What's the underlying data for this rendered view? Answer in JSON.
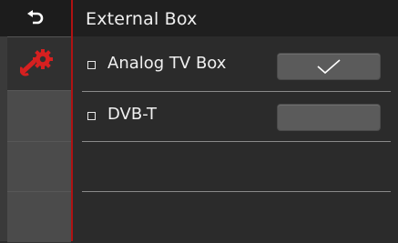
{
  "header": {
    "title": "External Box"
  },
  "sidebar": {
    "back_icon": "back-arrow-icon",
    "tabs": [
      {
        "icon": "settings-gear-wrench-icon",
        "active": true
      },
      {
        "icon": "",
        "active": false
      },
      {
        "icon": "",
        "active": false
      },
      {
        "icon": "",
        "active": false
      }
    ]
  },
  "options": [
    {
      "label": "Analog TV Box",
      "checked": true
    },
    {
      "label": "DVB-T",
      "checked": false
    }
  ],
  "colors": {
    "accent": "#b01212",
    "icon_red": "#d62020",
    "toggle": "#5b5b5b"
  }
}
